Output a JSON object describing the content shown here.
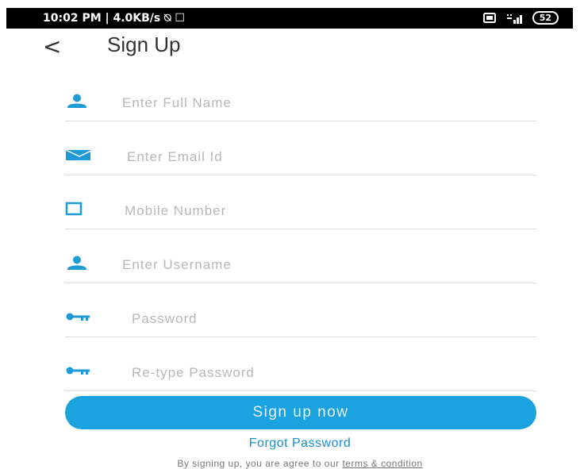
{
  "status_bar": {
    "time_info": "10:02 PM | 4.0KB/s ⍉ ☐",
    "battery": "52"
  },
  "header": {
    "back_glyph": "<",
    "title": "Sign Up"
  },
  "form": {
    "fields": [
      {
        "icon": "person-icon",
        "placeholder": "Enter Full Name",
        "value": ""
      },
      {
        "icon": "email-icon",
        "placeholder": "Enter Email Id",
        "value": ""
      },
      {
        "icon": "phone-icon",
        "placeholder": "Mobile Number",
        "value": ""
      },
      {
        "icon": "person-icon",
        "placeholder": "Enter Username",
        "value": ""
      },
      {
        "icon": "key-icon",
        "placeholder": "Password",
        "value": ""
      },
      {
        "icon": "key-icon",
        "placeholder": "Re-type Password",
        "value": ""
      }
    ],
    "submit_label": "Sign up now",
    "forgot_label": "Forgot Password",
    "terms_prefix": "By signing up, you are agree to our ",
    "terms_link": "terms & condition"
  },
  "colors": {
    "accent": "#1aa3df",
    "link": "#1a8ed0",
    "icon": "#1e9ad6"
  }
}
